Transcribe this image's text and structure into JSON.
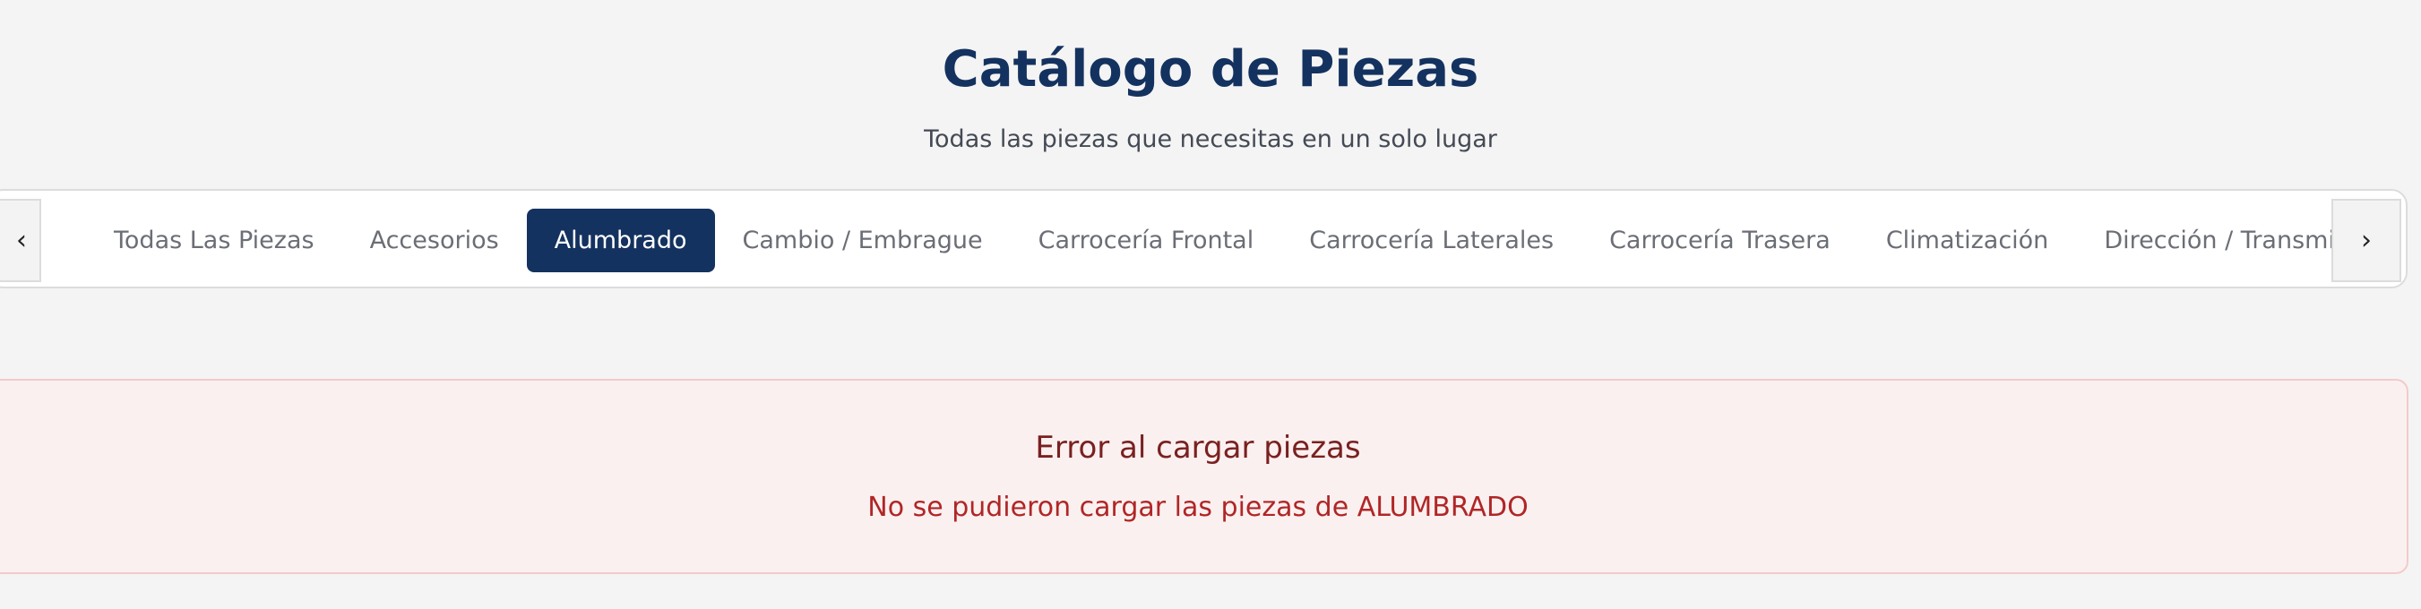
{
  "header": {
    "title": "Catálogo de Piezas",
    "subtitle": "Todas las piezas que necesitas en un solo lugar"
  },
  "nav": {
    "prev_icon": "chevron-left-icon",
    "next_icon": "chevron-right-icon",
    "prev_glyph": "‹",
    "next_glyph": "›",
    "active_index": 2,
    "tabs": [
      {
        "label": "Todas Las Piezas"
      },
      {
        "label": "Accesorios"
      },
      {
        "label": "Alumbrado"
      },
      {
        "label": "Cambio / Embrague"
      },
      {
        "label": "Carrocería Frontal"
      },
      {
        "label": "Carrocería Laterales"
      },
      {
        "label": "Carrocería Trasera"
      },
      {
        "label": "Climatización"
      },
      {
        "label": "Dirección / Transmisión"
      }
    ]
  },
  "error": {
    "title": "Error al cargar piezas",
    "message": "No se pudieron cargar las piezas de ALUMBRADO"
  },
  "colors": {
    "brand": "#14325f",
    "background": "#f4f4f4",
    "error_bg": "#fbf0f0",
    "error_border": "#f3caca",
    "error_title": "#7a2020",
    "error_text": "#b02626"
  }
}
